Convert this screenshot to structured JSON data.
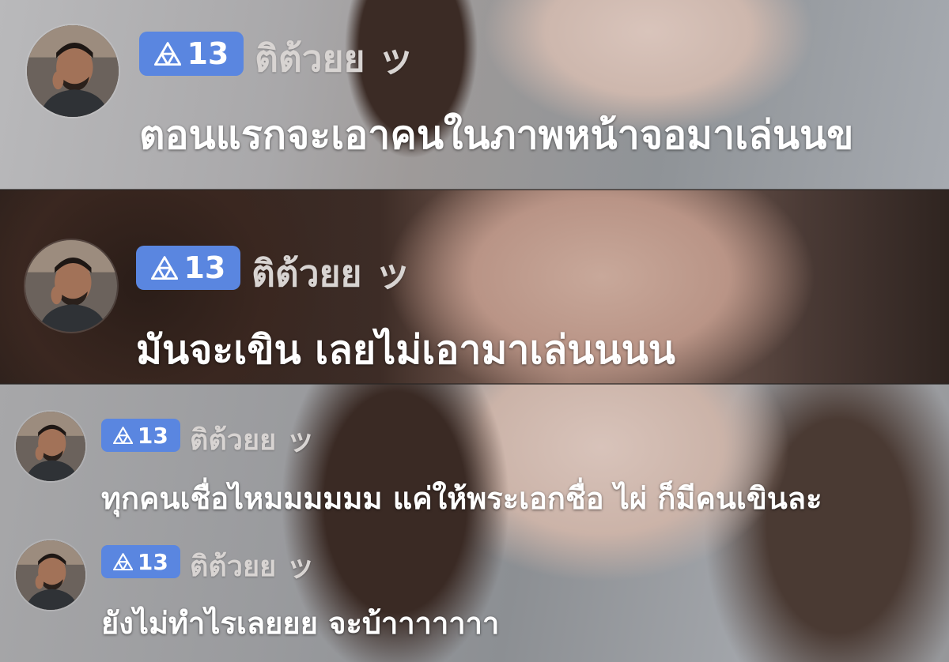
{
  "colors": {
    "badge_bg": "#5a86e0",
    "badge_text": "#ffffff",
    "username_text": "#d8d4d2",
    "message_text": "#ffffff"
  },
  "comments": [
    {
      "avatar_icon": "user-avatar",
      "badge": {
        "icon": "triangle-level-icon",
        "level": "13"
      },
      "username": "ติต้วยย ッ",
      "message": "ตอนแรกจะเอาคนในภาพหน้าจอมาเล่นนข"
    },
    {
      "avatar_icon": "user-avatar",
      "badge": {
        "icon": "triangle-level-icon",
        "level": "13"
      },
      "username": "ติต้วยย ッ",
      "message": "มันจะเขิน เลยไม่เอามาเล่นนนน"
    },
    {
      "avatar_icon": "user-avatar",
      "badge": {
        "icon": "triangle-level-icon",
        "level": "13"
      },
      "username": "ติต้วยย ッ",
      "message": "ทุกคนเชื่อไหมมมมมม แค่ให้พระเอกชื่อ ไผ่ ก็มีคนเขินละ"
    },
    {
      "avatar_icon": "user-avatar",
      "badge": {
        "icon": "triangle-level-icon",
        "level": "13"
      },
      "username": "ติต้วยย ッ",
      "message": "ยังไม่ทำไรเลยยย จะบ้าาาาาาา"
    }
  ]
}
